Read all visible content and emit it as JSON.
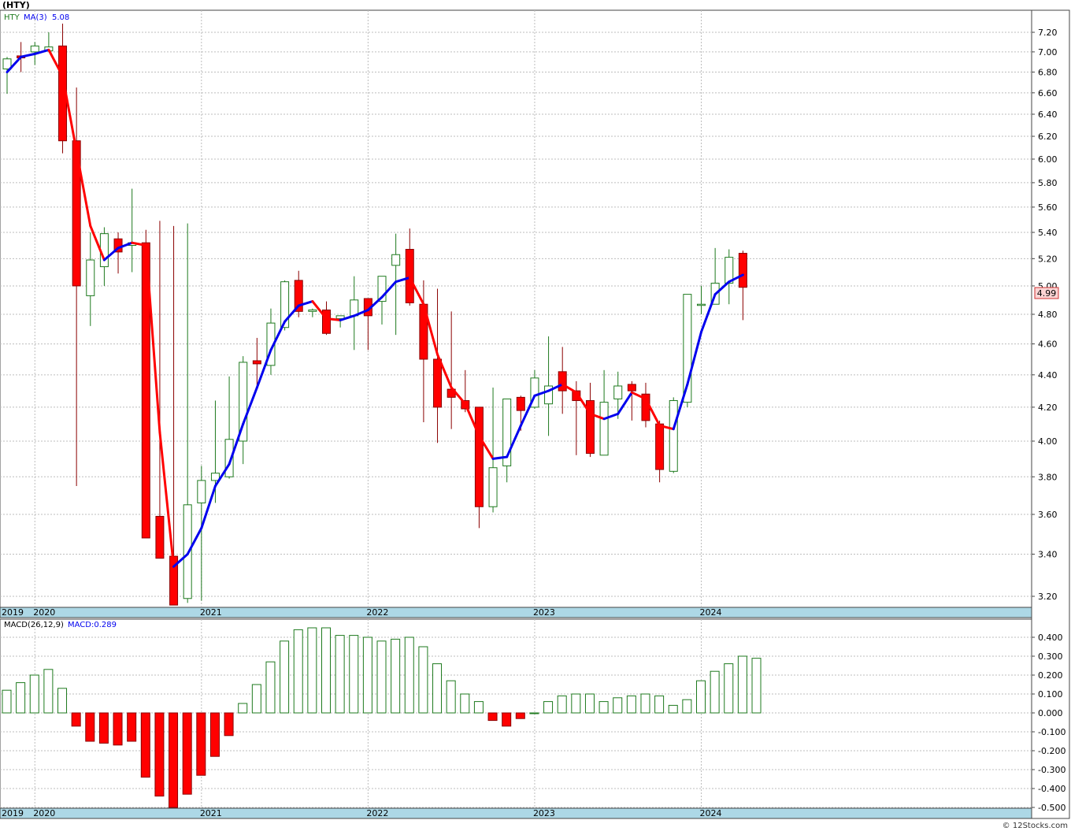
{
  "header": {
    "title": "(HTY)"
  },
  "price_panel": {
    "legend": {
      "symbol": "HTY",
      "ma_label": "MA(3)",
      "ma_value": "5.08"
    },
    "last_price_label": "4.99",
    "y_ticks": [
      "7.20",
      "7.00",
      "6.80",
      "6.60",
      "6.40",
      "6.20",
      "6.00",
      "5.80",
      "5.60",
      "5.40",
      "5.20",
      "5.00",
      "4.80",
      "4.60",
      "4.40",
      "4.20",
      "4.00",
      "3.80",
      "3.60",
      "3.40",
      "3.20"
    ]
  },
  "macd_panel": {
    "legend": {
      "label": "MACD(26,12,9)",
      "value_label": "MACD:0.289"
    },
    "y_ticks": [
      "0.400",
      "0.300",
      "0.200",
      "0.100",
      "0.000",
      "-0.100",
      "-0.200",
      "-0.300",
      "-0.400",
      "-0.500"
    ]
  },
  "x_axis": {
    "labels": [
      "2019",
      "2020",
      "2021",
      "2022",
      "2023",
      "2024"
    ]
  },
  "footer": {
    "copyright": "© 12Stocks.com"
  },
  "colors": {
    "up": "#1e7a1e",
    "down": "#ff0000",
    "ma_up": "#0000ee",
    "ma_down": "#ff0000",
    "axis_band": "#add8e6",
    "price_tag": "#fbd4d4"
  },
  "chart_data": [
    {
      "type": "candlestick",
      "symbol": "HTY",
      "interval": "monthly",
      "scale": "log",
      "ylim": [
        3.15,
        7.35
      ],
      "x": [
        "2019-11",
        "2019-12",
        "2020-01",
        "2020-02",
        "2020-03",
        "2020-04",
        "2020-05",
        "2020-06",
        "2020-07",
        "2020-08",
        "2020-09",
        "2020-10",
        "2020-11",
        "2020-12",
        "2021-01",
        "2021-02",
        "2021-03",
        "2021-04",
        "2021-05",
        "2021-06",
        "2021-07",
        "2021-08",
        "2021-09",
        "2021-10",
        "2021-11",
        "2021-12",
        "2022-01",
        "2022-02",
        "2022-03",
        "2022-04",
        "2022-05",
        "2022-06",
        "2022-07",
        "2022-08",
        "2022-09",
        "2022-10",
        "2022-11",
        "2022-12",
        "2023-01",
        "2023-02",
        "2023-03",
        "2023-04",
        "2023-05",
        "2023-06",
        "2023-07",
        "2023-08",
        "2023-09",
        "2023-10",
        "2023-11",
        "2023-12",
        "2024-01",
        "2024-02",
        "2024-03",
        "2024-04"
      ],
      "open": [
        6.83,
        6.96,
        7.0,
        7.01,
        7.06,
        6.16,
        4.93,
        5.14,
        5.35,
        5.3,
        5.32,
        3.59,
        3.39,
        3.19,
        3.66,
        3.78,
        3.8,
        4.0,
        4.49,
        4.46,
        4.71,
        5.04,
        4.82,
        4.83,
        4.77,
        4.79,
        4.91,
        4.89,
        5.15,
        5.27,
        4.87,
        4.5,
        4.31,
        4.24,
        4.2,
        3.64,
        3.86,
        4.26,
        4.2,
        4.22,
        4.42,
        4.3,
        4.24,
        3.92,
        4.25,
        4.34,
        4.28,
        4.1,
        3.83,
        4.23,
        4.87,
        4.87,
        5.02,
        5.24
      ],
      "high": [
        6.95,
        7.1,
        7.1,
        7.2,
        7.29,
        6.65,
        5.4,
        5.44,
        5.4,
        5.75,
        5.42,
        5.49,
        5.45,
        5.47,
        3.86,
        4.24,
        4.39,
        4.52,
        4.64,
        4.84,
        5.04,
        5.11,
        4.84,
        4.89,
        4.79,
        5.07,
        4.88,
        5.06,
        5.39,
        5.43,
        5.04,
        4.98,
        4.82,
        4.43,
        4.2,
        4.32,
        4.25,
        4.27,
        4.43,
        4.65,
        4.58,
        4.36,
        4.35,
        4.43,
        4.42,
        4.36,
        4.35,
        4.12,
        4.26,
        4.26,
        5.0,
        5.28,
        5.27,
        5.26
      ],
      "low": [
        6.59,
        6.8,
        6.87,
        7.0,
        6.05,
        3.75,
        4.72,
        5.0,
        5.09,
        5.1,
        5.28,
        3.45,
        3.3,
        3.17,
        3.18,
        3.66,
        3.79,
        3.87,
        4.32,
        4.4,
        4.69,
        4.78,
        4.78,
        4.66,
        4.71,
        4.56,
        4.56,
        4.73,
        4.66,
        4.86,
        4.11,
        3.99,
        4.07,
        4.17,
        3.53,
        3.61,
        3.77,
        4.06,
        4.19,
        4.03,
        4.16,
        3.92,
        3.91,
        4.2,
        4.13,
        4.12,
        4.08,
        3.77,
        3.82,
        4.2,
        4.8,
        4.87,
        4.87,
        4.76
      ],
      "close": [
        6.93,
        6.94,
        7.06,
        7.05,
        6.16,
        5.0,
        5.19,
        5.39,
        5.25,
        5.32,
        3.48,
        3.38,
        3.16,
        3.65,
        3.78,
        3.82,
        4.01,
        4.48,
        4.47,
        4.74,
        5.03,
        4.82,
        4.83,
        4.67,
        4.79,
        4.9,
        4.79,
        5.07,
        5.23,
        4.88,
        4.5,
        4.2,
        4.26,
        4.19,
        3.64,
        3.85,
        4.25,
        4.18,
        4.38,
        4.33,
        4.3,
        4.24,
        3.93,
        4.23,
        4.33,
        4.3,
        4.12,
        3.84,
        4.24,
        4.94,
        4.87,
        5.02,
        5.21,
        4.99
      ],
      "ma3": [
        6.8,
        6.95,
        6.98,
        7.02,
        6.76,
        6.07,
        5.45,
        5.19,
        5.28,
        5.32,
        5.3,
        4.05,
        3.34,
        3.4,
        3.53,
        3.75,
        3.87,
        4.1,
        4.32,
        4.56,
        4.75,
        4.86,
        4.89,
        4.77,
        4.76,
        4.79,
        4.83,
        4.92,
        5.03,
        5.06,
        4.87,
        4.53,
        4.32,
        4.22,
        4.03,
        3.9,
        3.91,
        4.09,
        4.27,
        4.3,
        4.34,
        4.29,
        4.16,
        4.13,
        4.16,
        4.29,
        4.25,
        4.09,
        4.07,
        4.34,
        4.68,
        4.94,
        5.03,
        5.08
      ]
    },
    {
      "type": "bar",
      "series": [
        {
          "name": "MACD(26,12,9)",
          "values": [
            0.12,
            0.16,
            0.2,
            0.23,
            0.13,
            -0.07,
            -0.15,
            -0.16,
            -0.17,
            -0.15,
            -0.34,
            -0.44,
            -0.5,
            -0.43,
            -0.33,
            -0.23,
            -0.12,
            0.05,
            0.15,
            0.27,
            0.38,
            0.44,
            0.45,
            0.45,
            0.41,
            0.41,
            0.4,
            0.38,
            0.39,
            0.4,
            0.35,
            0.26,
            0.17,
            0.1,
            0.06,
            -0.04,
            -0.07,
            -0.03,
            0.0,
            0.06,
            0.09,
            0.1,
            0.1,
            0.06,
            0.08,
            0.09,
            0.1,
            0.09,
            0.04,
            0.07,
            0.17,
            0.22,
            0.26,
            0.3,
            0.289
          ]
        }
      ],
      "ylim": [
        -0.5,
        0.43
      ]
    }
  ]
}
